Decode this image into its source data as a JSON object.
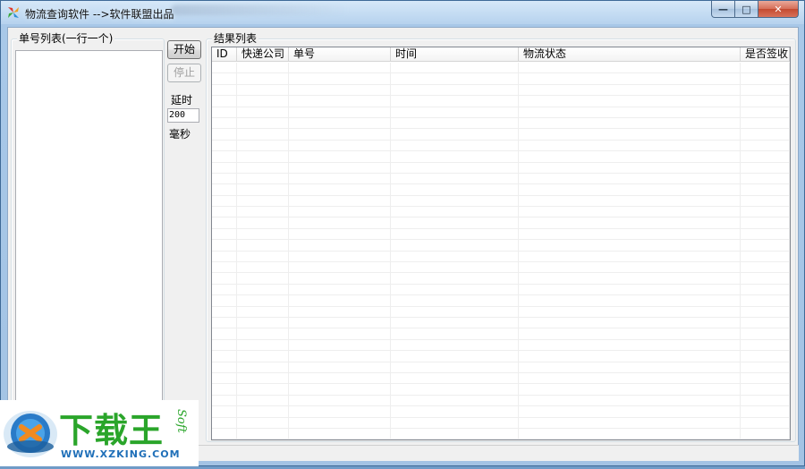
{
  "window": {
    "title": "物流查询软件 -->软件联盟出品",
    "minimize_glyph": "—",
    "maximize_glyph": "□",
    "close_glyph": "✕"
  },
  "left_panel": {
    "group_label": "单号列表(一行一个)",
    "textarea_value": ""
  },
  "controls": {
    "start_label": "开始",
    "stop_label": "停止",
    "delay_label": "延时",
    "delay_value": "200",
    "unit_label": "毫秒"
  },
  "results": {
    "group_label": "结果列表",
    "columns": [
      "ID",
      "快递公司",
      "单号",
      "时间",
      "物流状态",
      "是否签收"
    ],
    "row_count": 34
  },
  "watermark": {
    "brand": "下载王",
    "url": "WWW.XZKING.COM",
    "side_text": "Soft"
  },
  "colors": {
    "brand_green": "#2aa52a",
    "brand_blue": "#1f6fb8"
  }
}
